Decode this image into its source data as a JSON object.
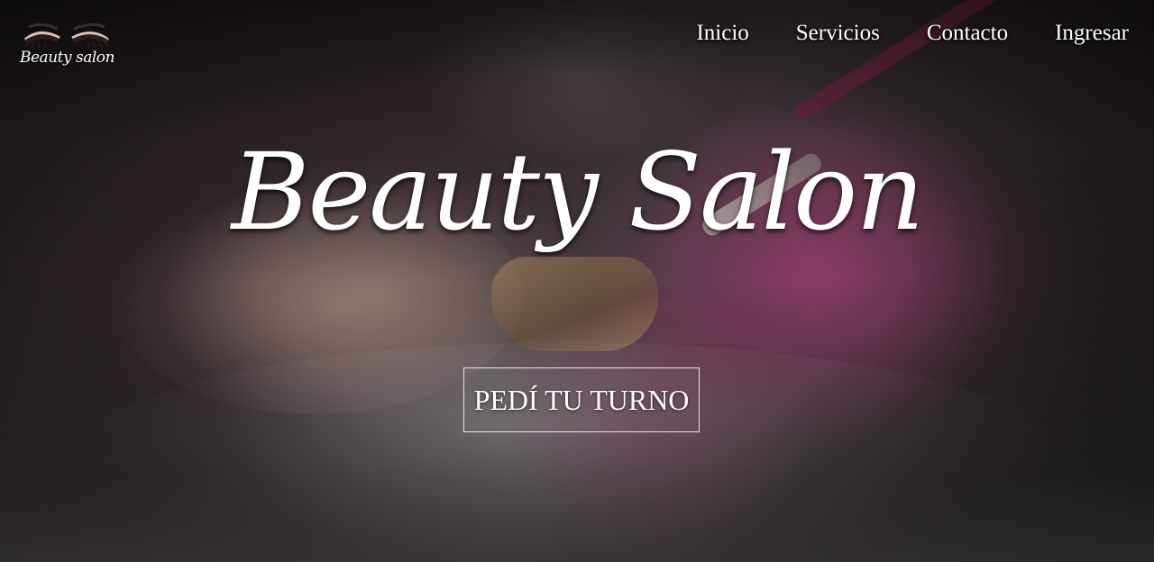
{
  "header": {
    "logo_text": "Beauty salon",
    "nav": [
      {
        "label": "Inicio"
      },
      {
        "label": "Servicios"
      },
      {
        "label": "Contacto"
      },
      {
        "label": "Ingresar"
      }
    ]
  },
  "hero": {
    "title": "Beauty Salon",
    "cta_label": "PEDÍ TU TURNO"
  }
}
